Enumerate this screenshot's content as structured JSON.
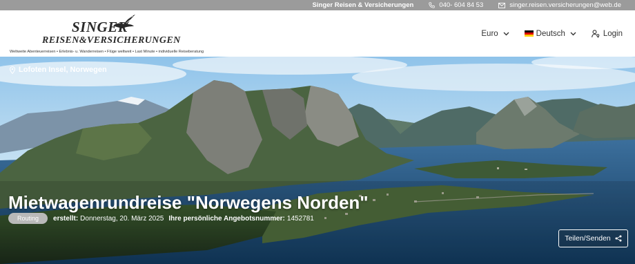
{
  "topbar": {
    "company": "Singer Reisen & Versicherungen",
    "phone": "040- 604 84 53",
    "email": "singer.reisen.versicherungen@web.de",
    "icons": {
      "phone": "phone-icon",
      "email": "mail-icon"
    }
  },
  "logo": {
    "line1": "SINGER",
    "line2": "REISEN&VERSICHERUNGEN",
    "tagline": "Weltweite Abenteuerreisen • Erlebnis- u. Wanderreisen • Flüge weltweit • Last Minute • individuelle Reiseberatung",
    "icon": "bird-icon"
  },
  "nav": {
    "currency": "Euro",
    "language": "Deutsch",
    "login": "Login",
    "icons": {
      "dropdown": "chevron-down-icon",
      "flag": "german-flag-icon",
      "login": "user-key-icon"
    }
  },
  "hero": {
    "location": "Lofoten Insel, Norwegen",
    "title": "Mietwagenrundreise \"Norwegens Norden\"",
    "badge": "Routing",
    "created_label": "erstellt:",
    "created_value": "Donnerstag, 20. März 2025",
    "offer_label": "Ihre persönliche Angebotsnummer:",
    "offer_value": "1452781",
    "share_label": "Teilen/Senden",
    "icons": {
      "location": "map-pin-icon",
      "share": "share-icon"
    }
  },
  "colors": {
    "topbar": "#9b9b9b",
    "text_dark": "#333333",
    "badge": "#b9b9b9",
    "sky": "#9cc9ea",
    "water": "#1d4d7a"
  }
}
